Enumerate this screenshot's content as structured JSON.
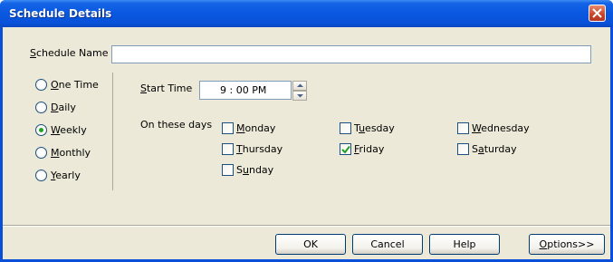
{
  "window": {
    "title": "Schedule Details"
  },
  "schedule_name": {
    "label": "Schedule Name",
    "accesskey": "S",
    "label_rest": "chedule Name",
    "value": ""
  },
  "frequency": {
    "options": [
      {
        "accesskey": "O",
        "rest": "ne Time",
        "selected": false
      },
      {
        "accesskey": "D",
        "rest": "aily",
        "selected": false
      },
      {
        "accesskey": "W",
        "rest": "eekly",
        "selected": true
      },
      {
        "accesskey": "M",
        "rest": "onthly",
        "selected": false
      },
      {
        "accesskey": "Y",
        "rest": "early",
        "selected": false
      }
    ]
  },
  "start_time": {
    "accesskey": "S",
    "rest": "tart Time",
    "value": "9 : 00 PM"
  },
  "days": {
    "label": "On these days",
    "items": [
      {
        "accesskey": "M",
        "rest": "onday",
        "checked": false
      },
      {
        "pre": "T",
        "accesskey": "u",
        "rest": "esday",
        "checked": false
      },
      {
        "accesskey": "W",
        "rest": "ednesday",
        "checked": false
      },
      {
        "accesskey": "T",
        "rest": "hursday",
        "checked": false
      },
      {
        "accesskey": "F",
        "rest": "riday",
        "checked": true
      },
      {
        "pre": "S",
        "accesskey": "a",
        "rest": "turday",
        "checked": false
      },
      {
        "pre": "S",
        "accesskey": "u",
        "rest": "nday",
        "checked": false
      }
    ]
  },
  "buttons": {
    "ok": "OK",
    "cancel": "Cancel",
    "help": "Help",
    "options_accesskey": "O",
    "options_rest": "ptions>>"
  }
}
